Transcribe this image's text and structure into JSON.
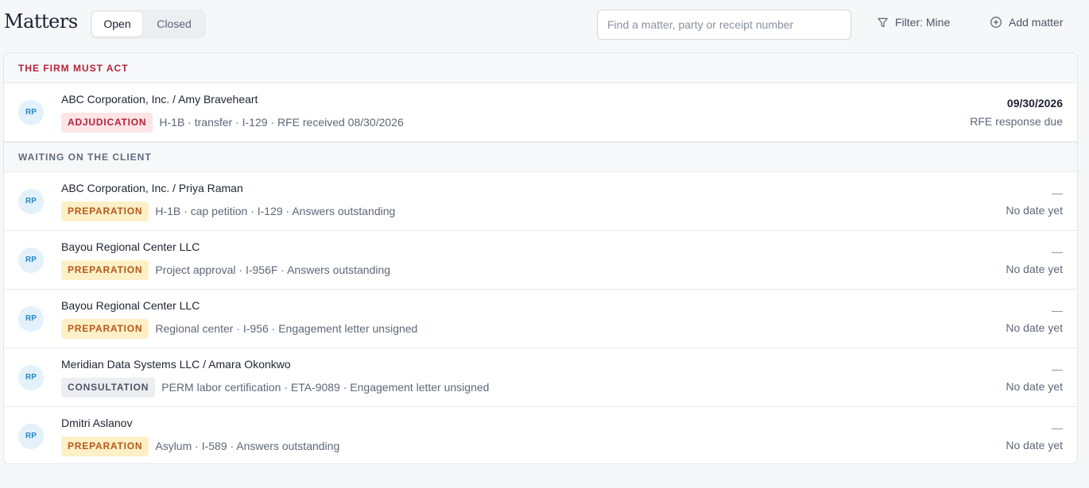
{
  "header": {
    "title": "Matters",
    "tabs": [
      {
        "label": "Open",
        "active": true
      },
      {
        "label": "Closed",
        "active": false
      }
    ],
    "search_placeholder": "Find a matter, party or receipt number",
    "filter_label": "Filter: Mine",
    "add_label": "Add matter"
  },
  "sections": {
    "urgent": {
      "label": "THE FIRM MUST ACT",
      "rows": [
        {
          "avatar": "RP",
          "title": "ABC Corporation, Inc. / Amy Braveheart",
          "badge": "ADJUDICATION",
          "details": "H-1B · transfer · I-129 · RFE received 08/30/2026",
          "date": "09/30/2026",
          "note": "RFE response due"
        }
      ]
    },
    "waiting": {
      "label": "WAITING ON THE CLIENT",
      "rows": [
        {
          "avatar": "RP",
          "title": "ABC Corporation, Inc. / Priya Raman",
          "badge": "PREPARATION",
          "details": "H-1B · cap petition · I-129 · Answers outstanding",
          "date": "—",
          "note": "No date yet"
        },
        {
          "avatar": "RP",
          "title": "Bayou Regional Center LLC",
          "badge": "PREPARATION",
          "details": "Project approval · I-956F · Answers outstanding",
          "date": "—",
          "note": "No date yet"
        },
        {
          "avatar": "RP",
          "title": "Bayou Regional Center LLC",
          "badge": "PREPARATION",
          "details": "Regional center · I-956 · Engagement letter unsigned",
          "date": "—",
          "note": "No date yet"
        },
        {
          "avatar": "RP",
          "title": "Meridian Data Systems LLC / Amara Okonkwo",
          "badge": "CONSULTATION",
          "details": "PERM labor certification · ETA-9089 · Engagement letter unsigned",
          "date": "—",
          "note": "No date yet"
        },
        {
          "avatar": "RP",
          "title": "Dmitri Aslanov",
          "badge": "PREPARATION",
          "details": "Asylum · I-589 · Answers outstanding",
          "date": "—",
          "note": "No date yet"
        }
      ]
    }
  },
  "colors": {
    "urgent_accent": "#b3233a",
    "preparation_badge": "#fdf0c7",
    "adjudication_badge": "#fde4e7",
    "consultation_badge": "#eceef2",
    "avatar_bg": "#e3f1fb"
  },
  "icons": {
    "filter": "funnel-icon",
    "add": "plus-circle-icon"
  }
}
